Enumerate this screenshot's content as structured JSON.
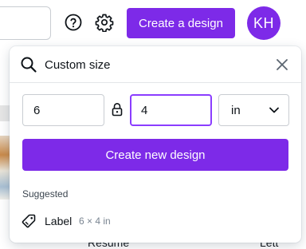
{
  "header": {
    "create_button_label": "Create a design",
    "avatar_initials": "KH",
    "help_icon": "question-circle-icon",
    "settings_icon": "gear-icon"
  },
  "background": {
    "labels": [
      "Resume",
      "Lett"
    ]
  },
  "popover": {
    "search": {
      "value": "Custom size",
      "icon": "search-icon",
      "clear_icon": "close-icon"
    },
    "width_value": "6",
    "height_value": "4",
    "lock_icon": "lock-icon",
    "unit": {
      "selected": "in",
      "icon": "chevron-down-icon"
    },
    "create_new_label": "Create new design",
    "suggested_heading": "Suggested",
    "suggestions": [
      {
        "name": "Label",
        "dims": "6 × 4 in",
        "icon": "tag-icon"
      }
    ]
  },
  "colors": {
    "accent": "#7d2ae8",
    "focus_border": "#8b3dff",
    "text": "#0e1318",
    "muted": "#7a8591"
  }
}
